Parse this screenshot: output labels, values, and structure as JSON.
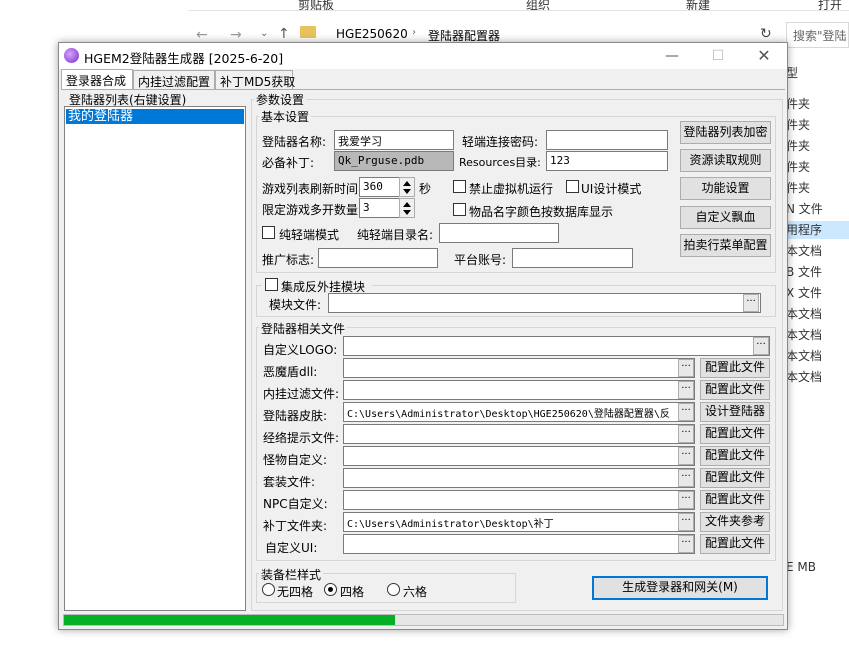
{
  "explorer": {
    "ribbon": [
      "剪贴板",
      "组织",
      "新建",
      "打开"
    ],
    "path": [
      "HGE250620",
      "登陆器配置器"
    ],
    "search_placeholder": "搜索\"登陆",
    "items": [
      "型",
      "件夹",
      "件夹",
      "件夹",
      "件夹",
      "件夹",
      "N 文件",
      "用程序",
      "本文档",
      "B 文件",
      "X 文件",
      "本文档",
      "本文档",
      "本文档",
      "本文档",
      "E MB"
    ]
  },
  "window": {
    "title": "HGEM2登陆器生成器 [2025-6-20]",
    "tabs": [
      "登录器合成",
      "内挂过滤配置",
      "补丁MD5获取"
    ],
    "left": {
      "legend": "登陆器列表(右键设置)",
      "items": [
        "我的登陆器"
      ]
    },
    "params_legend": "参数设置",
    "basic": {
      "legend": "基本设置",
      "name_label": "登陆器名称:",
      "name_value": "我爱学习",
      "light_pwd_label": "轻端连接密码:",
      "light_pwd_value": "",
      "patch_label": "必备补丁:",
      "patch_value": "Qk_Prguse.pdb",
      "res_label": "Resources目录:",
      "res_value": "123",
      "refresh_label": "游戏列表刷新时间",
      "refresh_value": "360",
      "refresh_unit": "秒",
      "multi_label": "限定游戏多开数量",
      "multi_value": "3",
      "vm_label": "禁止虚拟机运行",
      "ui_mode_label": "UI设计模式",
      "item_color_label": "物品名字颜色按数据库显示",
      "pure_light_label": "纯轻端模式",
      "pure_dir_label": "纯轻端目录名:",
      "pure_dir_value": "",
      "promo_label": "推广标志:",
      "promo_value": "",
      "platform_label": "平台账号:",
      "platform_value": ""
    },
    "side_buttons": [
      "登陆器列表加密",
      "资源读取规则",
      "功能设置",
      "自定义飘血",
      "拍卖行菜单配置"
    ],
    "anti": {
      "legend": "集成反外挂模块",
      "module_label": "模块文件:",
      "module_value": ""
    },
    "files": {
      "legend": "登陆器相关文件",
      "rows": [
        {
          "label": "自定义LOGO:",
          "value": "",
          "button": ""
        },
        {
          "label": "恶魔盾dll:",
          "value": "",
          "button": "配置此文件"
        },
        {
          "label": "内挂过滤文件:",
          "value": "",
          "button": "配置此文件"
        },
        {
          "label": "登陆器皮肤:",
          "value": "C:\\Users\\Administrator\\Desktop\\HGE250620\\登陆器配置器\\反",
          "button": "设计登陆器"
        },
        {
          "label": "经络提示文件:",
          "value": "",
          "button": "配置此文件"
        },
        {
          "label": "怪物自定义:",
          "value": "",
          "button": "配置此文件"
        },
        {
          "label": "套装文件:",
          "value": "",
          "button": "配置此文件"
        },
        {
          "label": "NPC自定义:",
          "value": "",
          "button": "配置此文件"
        },
        {
          "label": "补丁文件夹:",
          "value": "C:\\Users\\Administrator\\Desktop\\补丁",
          "button": "文件夹参考"
        },
        {
          "label": "自定义UI:",
          "value": "",
          "button": "配置此文件"
        }
      ]
    },
    "equip": {
      "legend": "装备栏样式",
      "options": [
        "无四格",
        "四格",
        "六格"
      ],
      "selected": "四格"
    },
    "generate_button": "生成登录器和网关(M)",
    "progress": 0.46,
    "colors": {
      "progress": "#06b025",
      "selection": "#0078d7"
    }
  }
}
